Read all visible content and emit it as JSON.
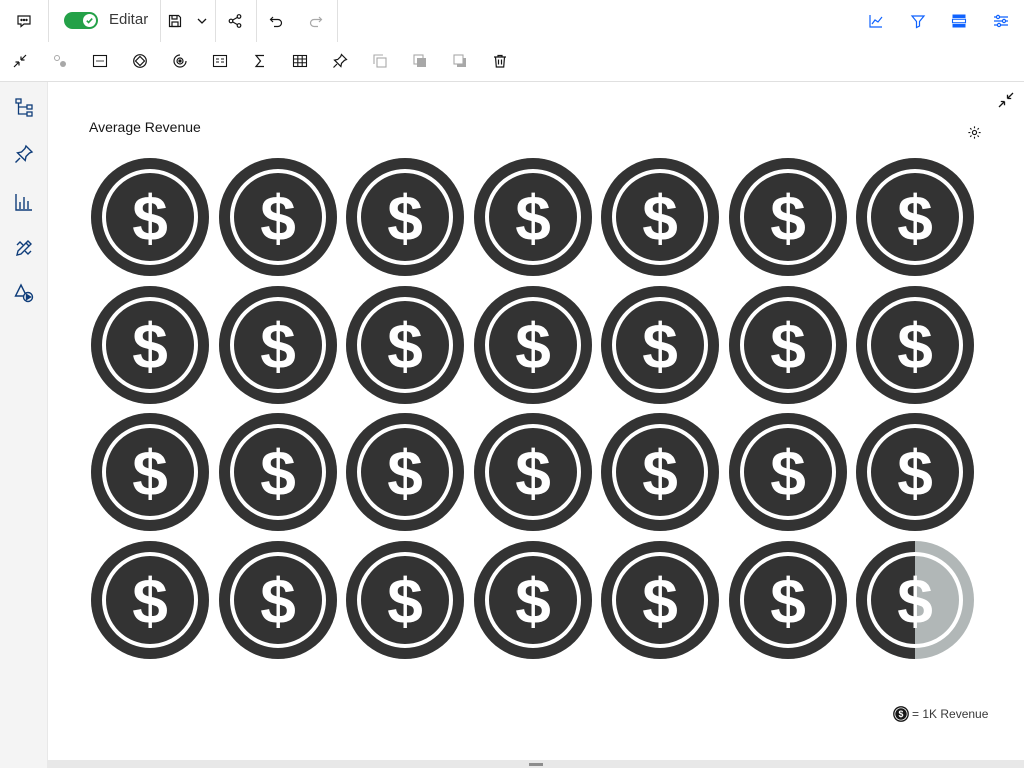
{
  "toolbar": {
    "edit_label": "Editar",
    "edit_enabled": true,
    "accent": "#24a148",
    "row1_left_icons": [
      "comment-icon",
      "save-icon",
      "chevron-down-icon",
      "share-icon",
      "undo-icon",
      "redo-icon"
    ],
    "row1_right_icons": [
      "insights-icon",
      "filter-icon",
      "data-tray-icon",
      "properties-icon"
    ],
    "row2_icons": [
      "collapse-icon",
      "connect-icon",
      "image-icon",
      "navigate-icon",
      "target-icon",
      "text-icon",
      "summation-icon",
      "table-icon",
      "pin-icon",
      "duplicate-icon",
      "bring-forward-icon",
      "send-backward-icon",
      "delete-icon"
    ]
  },
  "leftrail": {
    "icons": [
      "hierarchy-icon",
      "pin-icon",
      "bar-chart-icon",
      "design-icon",
      "shapes-icon"
    ]
  },
  "viz": {
    "title": "Average Revenue",
    "legend_text": "= 1K Revenue",
    "coin_color": "#333333",
    "coin_faded_color": "#b1b7b7"
  },
  "chart_data": {
    "type": "pictogram",
    "title": "Average Revenue",
    "unit": "1K Revenue",
    "icon": "dollar-coin-icon",
    "columns": 7,
    "rows": 4,
    "value": 27.5,
    "legend": "= 1K Revenue"
  }
}
